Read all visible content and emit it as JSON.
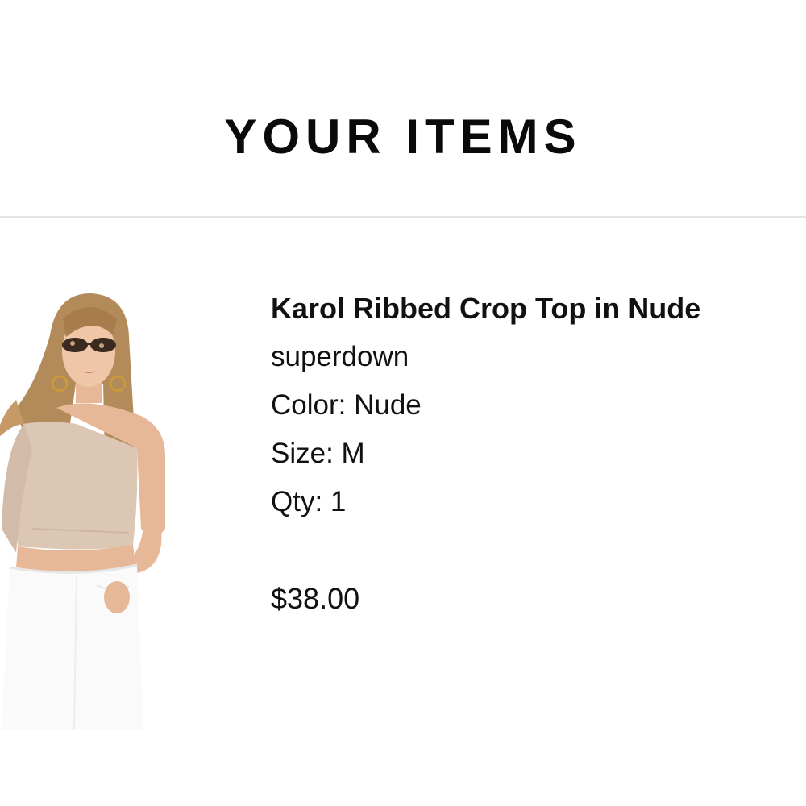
{
  "header": {
    "title": "YOUR ITEMS"
  },
  "items": [
    {
      "name": "Karol Ribbed Crop Top in Nude",
      "brand": "superdown",
      "color": "Color: Nude",
      "size": "Size: M",
      "qty": "Qty: 1",
      "price": "$38.00",
      "image": "product-photo-model-crop-top"
    }
  ],
  "colors": {
    "text": "#111111",
    "divider": "#e3e3e3",
    "top_fabric": "#dcc7b5",
    "jeans": "#ffffff"
  }
}
